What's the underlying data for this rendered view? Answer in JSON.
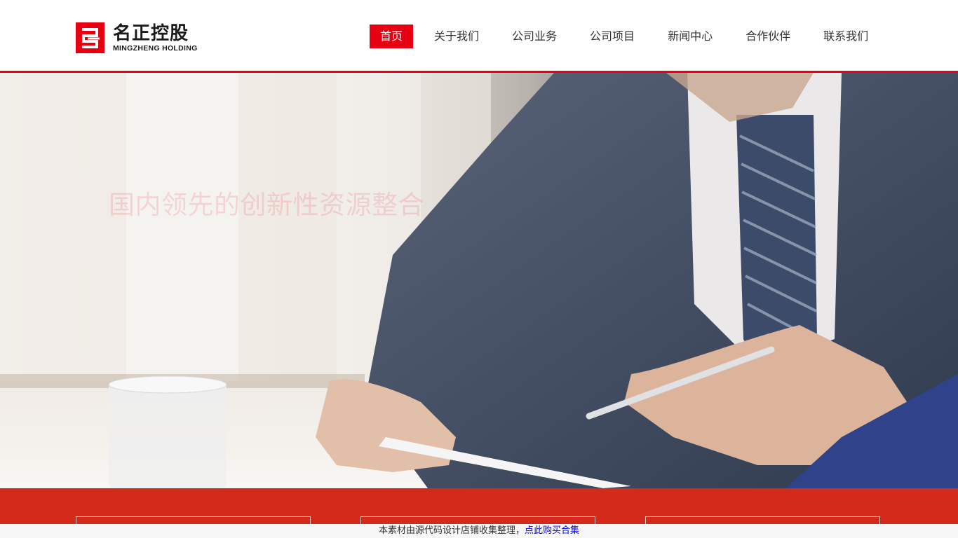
{
  "brand": {
    "name_cn": "名正控股",
    "name_en": "MINGZHENG HOLDING",
    "color": "#e60012"
  },
  "nav": {
    "items": [
      {
        "label": "首页",
        "active": true
      },
      {
        "label": "关于我们",
        "active": false
      },
      {
        "label": "公司业务",
        "active": false
      },
      {
        "label": "公司项目",
        "active": false
      },
      {
        "label": "新闻中心",
        "active": false
      },
      {
        "label": "合作伙伴",
        "active": false
      },
      {
        "label": "联系我们",
        "active": false
      }
    ]
  },
  "hero": {
    "slogan": "国内领先的创新性资源整合"
  },
  "band": {
    "color": "#d42a1c"
  },
  "notice": {
    "text": "本素材由源代码设计店铺收集整理，",
    "link": "点此购买合集"
  }
}
